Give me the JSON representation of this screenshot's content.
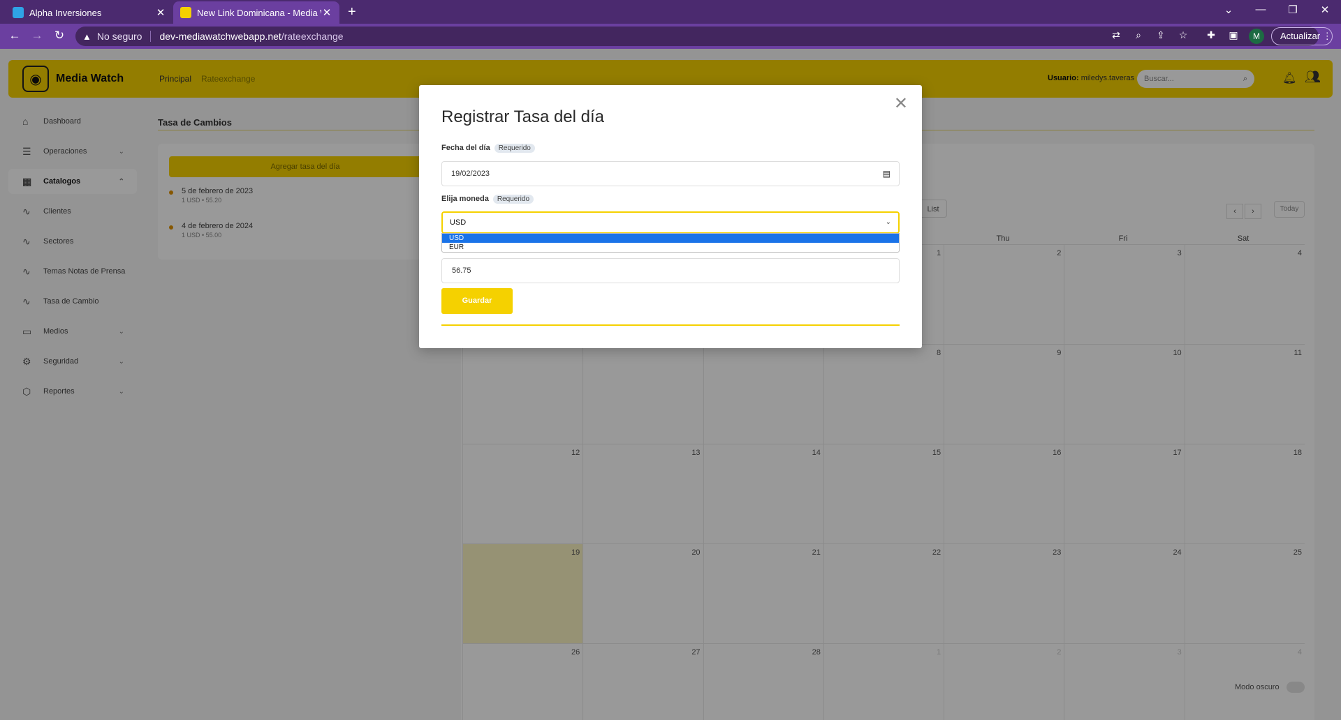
{
  "browser": {
    "tabs": [
      {
        "title": "Alpha Inversiones",
        "favicon_color": "#2fa3e6"
      },
      {
        "title": "New Link Dominicana - Media W",
        "favicon_color": "#f5d100"
      }
    ],
    "url_warning": "No seguro",
    "url_host": "dev-mediawatchwebapp.net",
    "url_path": "/rateexchange",
    "profile_initial": "M",
    "update_label": "Actualizar"
  },
  "app": {
    "brand": "Media Watch",
    "breadcrumb": {
      "home": "Principal",
      "current": "Rateexchange"
    },
    "user_label": "Usuario:",
    "user_name": "miledys.taveras",
    "search_placeholder": "Buscar...",
    "sidebar": [
      {
        "label": "Dashboard",
        "icon": "home-icon",
        "has_chevron": false
      },
      {
        "label": "Operaciones",
        "icon": "database-icon",
        "has_chevron": true
      },
      {
        "label": "Catalogos",
        "icon": "catalog-icon",
        "has_chevron": true,
        "active": true
      },
      {
        "label": "Clientes",
        "icon": "activity-icon",
        "has_chevron": false
      },
      {
        "label": "Sectores",
        "icon": "activity-icon",
        "has_chevron": false
      },
      {
        "label": "Temas Notas de Prensa",
        "icon": "activity-icon",
        "has_chevron": false
      },
      {
        "label": "Tasa de Cambio",
        "icon": "activity-icon",
        "has_chevron": false
      },
      {
        "label": "Medios",
        "icon": "tv-icon",
        "has_chevron": true
      },
      {
        "label": "Seguridad",
        "icon": "gear-icon",
        "has_chevron": true
      },
      {
        "label": "Reportes",
        "icon": "box-icon",
        "has_chevron": true
      }
    ],
    "page_title": "Tasa de Cambios",
    "add_button": "Agregar tasa del día",
    "rates": [
      {
        "date": "5 de febrero de 2023",
        "detail": "1 USD  •  55.20"
      },
      {
        "date": "4 de febrero de 2024",
        "detail": "1 USD  •  55.00"
      }
    ],
    "calendar": {
      "list_label": "List",
      "today_label": "Today",
      "weekdays": [
        "Thu",
        "Fri",
        "Sat"
      ],
      "weeks": [
        [
          "",
          "",
          "",
          "",
          "1",
          "2",
          "3",
          "4"
        ],
        [
          "",
          "",
          "",
          "",
          "8",
          "9",
          "10",
          "11"
        ],
        [
          "12",
          "13",
          "14",
          "15",
          "16",
          "17",
          "18"
        ],
        [
          "19",
          "20",
          "21",
          "22",
          "23",
          "24",
          "25"
        ],
        [
          "26",
          "27",
          "28",
          "1",
          "2",
          "3",
          "4"
        ]
      ]
    },
    "dark_mode_label": "Modo oscuro"
  },
  "modal": {
    "title": "Registrar Tasa del día",
    "date_label": "Fecha del día",
    "required_badge": "Requerido",
    "date_value": "19/02/2023",
    "currency_label": "Elija moneda",
    "currency_selected": "USD",
    "currency_options": [
      "USD",
      "EUR"
    ],
    "rate_value": "56.75",
    "save_label": "Guardar"
  }
}
